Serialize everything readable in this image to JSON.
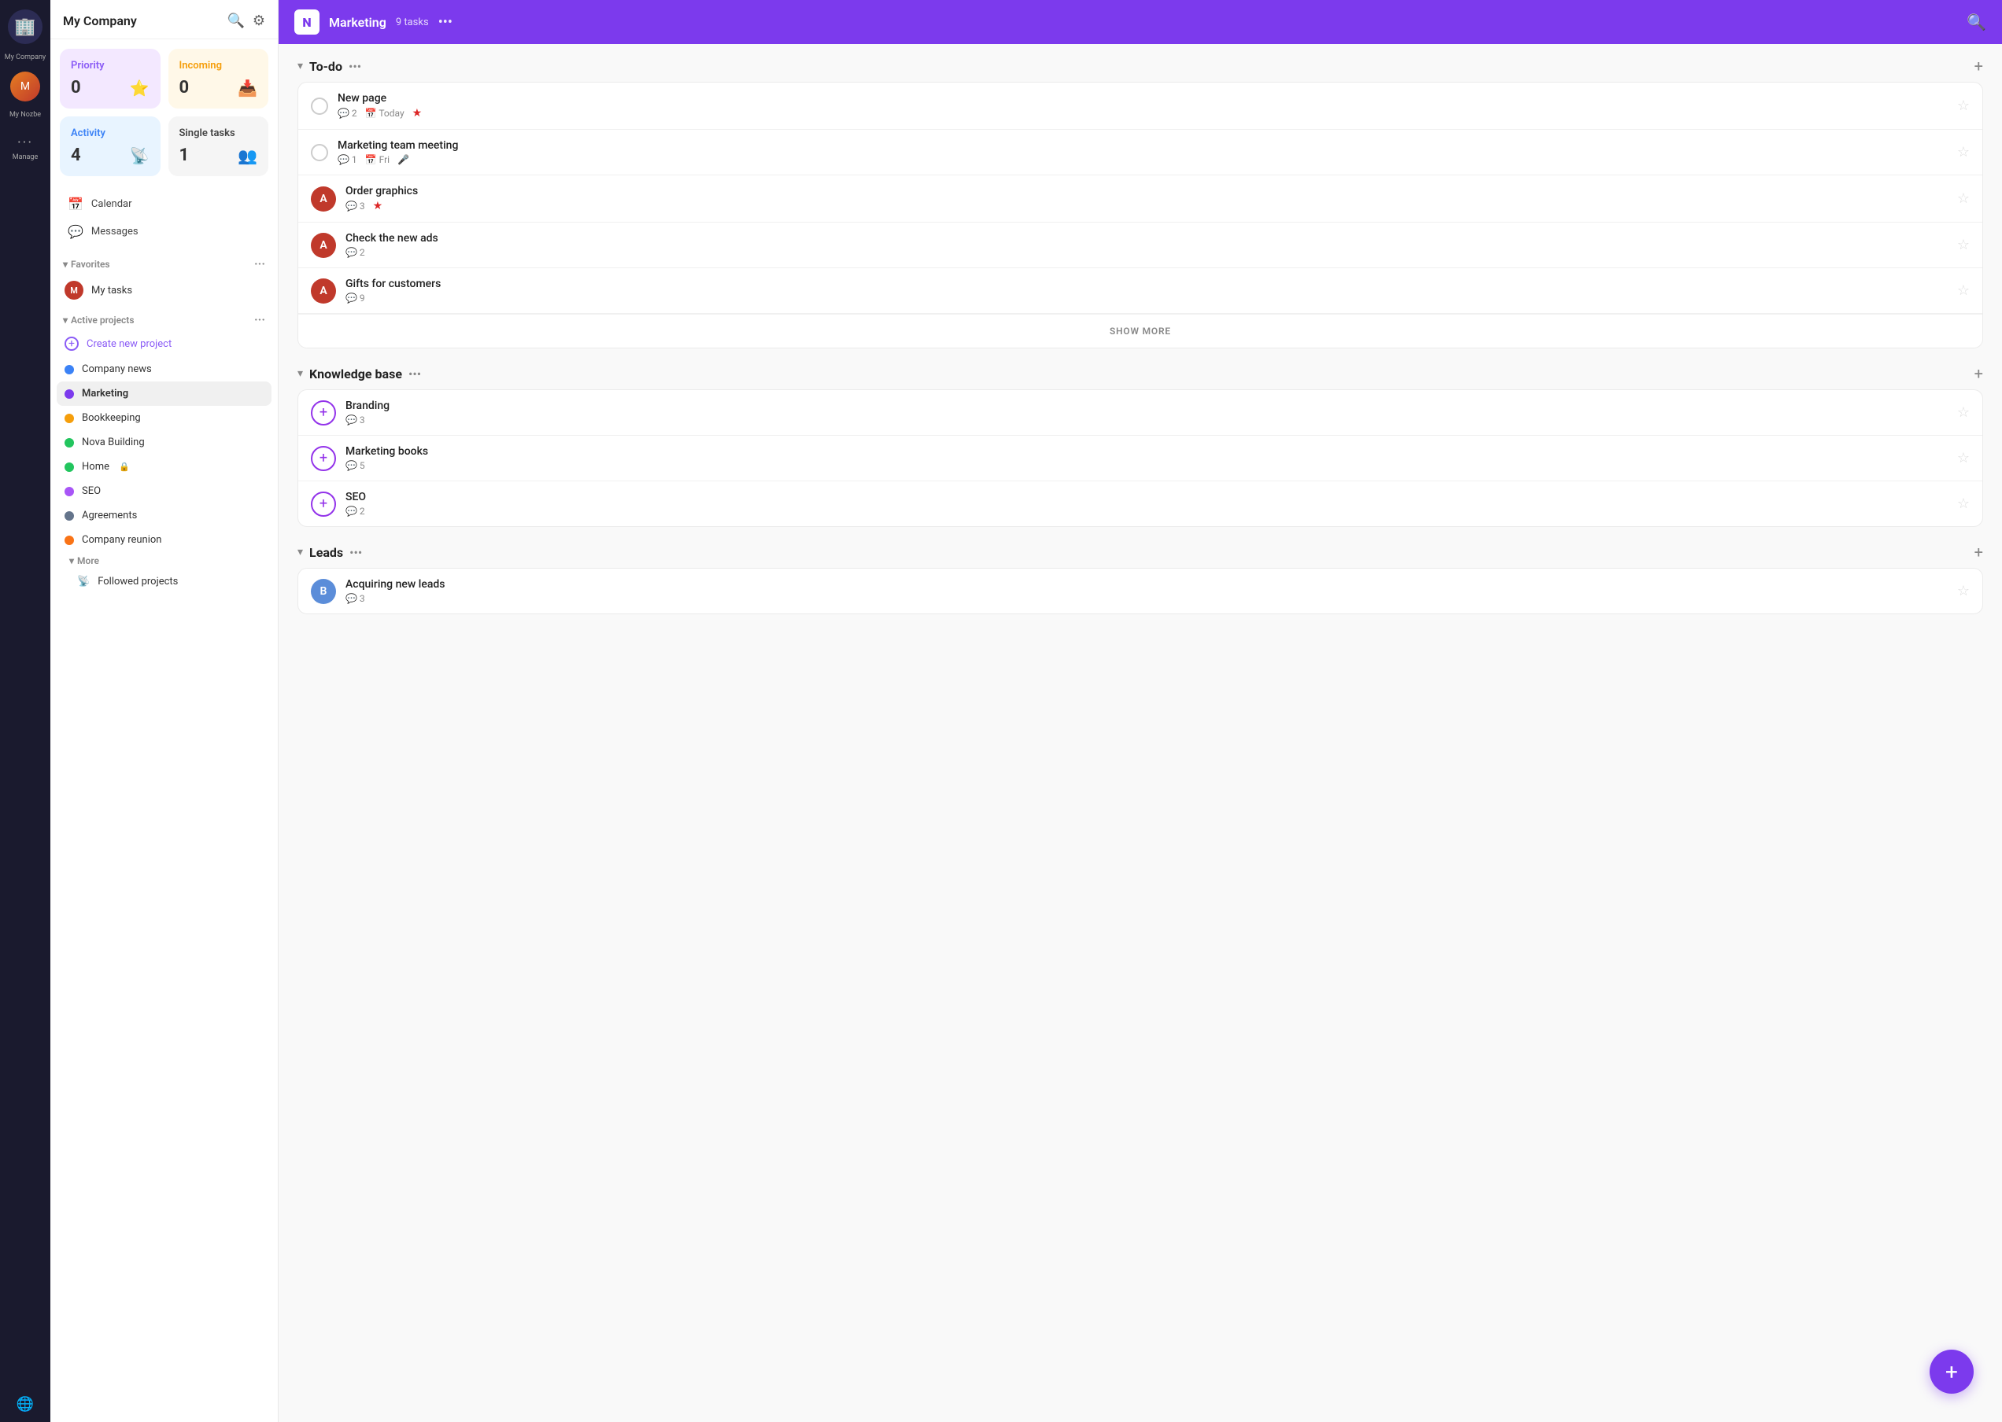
{
  "iconBar": {
    "companyLabel": "My Company",
    "myNozbeLabel": "My Nozbe",
    "manageLabel": "Manage"
  },
  "sidebar": {
    "title": "My Company",
    "searchIcon": "🔍",
    "settingsIcon": "⚙",
    "cards": {
      "priority": {
        "title": "Priority",
        "count": "0",
        "icon": "⭐"
      },
      "incoming": {
        "title": "Incoming",
        "count": "0",
        "icon": "📥"
      },
      "activity": {
        "title": "Activity",
        "count": "4",
        "icon": "📡"
      },
      "single": {
        "title": "Single tasks",
        "count": "1",
        "icon": "👥"
      }
    },
    "navItems": [
      {
        "id": "calendar",
        "label": "Calendar",
        "icon": "📅"
      },
      {
        "id": "messages",
        "label": "Messages",
        "icon": "💬"
      }
    ],
    "favoritesSection": {
      "title": "Favorites",
      "items": [
        {
          "id": "my-tasks",
          "label": "My tasks",
          "avatarBg": "#c0392b"
        }
      ]
    },
    "activeProjectsSection": {
      "title": "Active projects",
      "createLabel": "Create new project",
      "projects": [
        {
          "id": "company-news",
          "label": "Company news",
          "color": "#3b82f6"
        },
        {
          "id": "marketing",
          "label": "Marketing",
          "color": "#7c3aed",
          "active": true
        },
        {
          "id": "bookkeeping",
          "label": "Bookkeeping",
          "color": "#f59e0b"
        },
        {
          "id": "nova-building",
          "label": "Nova Building",
          "color": "#22c55e"
        },
        {
          "id": "home",
          "label": "Home",
          "color": "#22c55e",
          "lock": true
        },
        {
          "id": "seo",
          "label": "SEO",
          "color": "#a855f7"
        },
        {
          "id": "agreements",
          "label": "Agreements",
          "color": "#64748b"
        },
        {
          "id": "company-reunion",
          "label": "Company reunion",
          "color": "#f97316"
        }
      ]
    },
    "moreSection": {
      "title": "More",
      "items": [
        {
          "id": "followed-projects",
          "label": "Followed projects",
          "icon": "📡"
        }
      ]
    }
  },
  "topbar": {
    "title": "Marketing",
    "taskCount": "9 tasks",
    "dotsLabel": "•••",
    "logoChar": "N"
  },
  "taskGroups": [
    {
      "id": "todo",
      "title": "To-do",
      "tasks": [
        {
          "id": "new-page",
          "title": "New page",
          "commentCount": "2",
          "date": "Today",
          "hasPriority": true,
          "avatarType": "checkbox"
        },
        {
          "id": "marketing-meeting",
          "title": "Marketing team meeting",
          "commentCount": "1",
          "date": "Fri",
          "hasMic": true,
          "avatarType": "checkbox"
        },
        {
          "id": "order-graphics",
          "title": "Order graphics",
          "commentCount": "3",
          "hasPriority": true,
          "avatarBg": "#c0392b",
          "avatarChar": "A",
          "avatarType": "user"
        },
        {
          "id": "check-new-ads",
          "title": "Check the new ads",
          "commentCount": "2",
          "avatarBg": "#c0392b",
          "avatarChar": "A",
          "avatarType": "user"
        },
        {
          "id": "gifts-customers",
          "title": "Gifts for customers",
          "commentCount": "9",
          "avatarBg": "#c0392b",
          "avatarChar": "A",
          "avatarType": "user"
        }
      ],
      "showMore": "SHOW MORE"
    },
    {
      "id": "knowledge-base",
      "title": "Knowledge base",
      "tasks": [
        {
          "id": "branding",
          "title": "Branding",
          "commentCount": "3",
          "avatarType": "add"
        },
        {
          "id": "marketing-books",
          "title": "Marketing books",
          "commentCount": "5",
          "avatarType": "add"
        },
        {
          "id": "seo-task",
          "title": "SEO",
          "commentCount": "2",
          "avatarType": "add"
        }
      ]
    },
    {
      "id": "leads",
      "title": "Leads",
      "tasks": [
        {
          "id": "acquiring-leads",
          "title": "Acquiring new leads",
          "commentCount": "3",
          "avatarBg": "#5b8dd9",
          "avatarChar": "B",
          "avatarType": "user"
        }
      ]
    }
  ],
  "fab": {
    "icon": "+"
  },
  "colors": {
    "purple": "#7c3aed",
    "priorityBg": "#f3e8ff",
    "incomingBg": "#fff8e8",
    "activityBg": "#e8f4ff"
  }
}
